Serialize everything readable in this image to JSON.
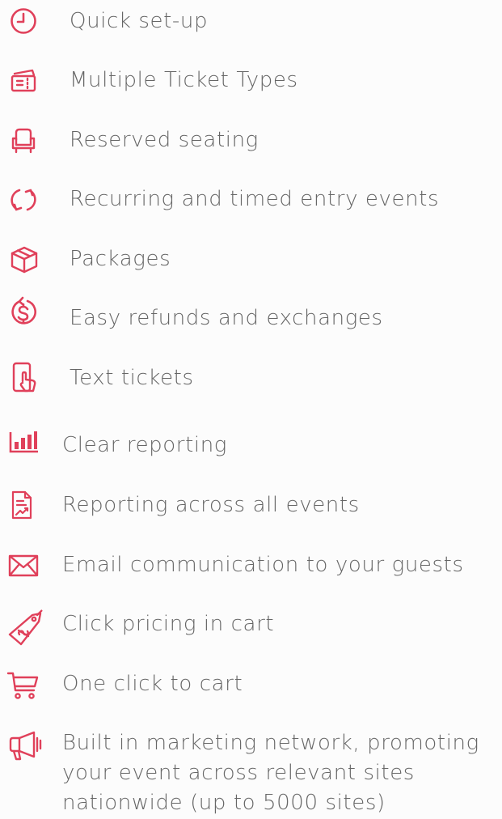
{
  "features": [
    {
      "label": "Quick set-up",
      "icon": "clock-icon"
    },
    {
      "label": "Multiple Ticket Types",
      "icon": "tickets-icon"
    },
    {
      "label": "Reserved seating",
      "icon": "seat-icon"
    },
    {
      "label": "Recurring and timed entry events",
      "icon": "recurring-arrows-icon"
    },
    {
      "label": "Packages",
      "icon": "package-box-icon"
    },
    {
      "label": "Easy refunds and exchanges",
      "icon": "refund-dollar-icon"
    },
    {
      "label": "Text tickets",
      "icon": "phone-tap-icon"
    },
    {
      "label": "Clear reporting",
      "icon": "bar-chart-icon"
    },
    {
      "label": "Reporting across all events",
      "icon": "report-document-icon"
    },
    {
      "label": "Email communication to your guests",
      "icon": "envelope-icon"
    },
    {
      "label": "Click pricing in cart",
      "icon": "price-tag-icon"
    },
    {
      "label": "One click to cart",
      "icon": "cart-icon"
    },
    {
      "label": "Built in marketing network, promoting\nyour event across relevant sites\nnationwide (up to 5000 sites)",
      "icon": "megaphone-icon"
    }
  ],
  "colors": {
    "accent": "#e0405a",
    "text": "#666666",
    "background": "#fcfcfc"
  }
}
